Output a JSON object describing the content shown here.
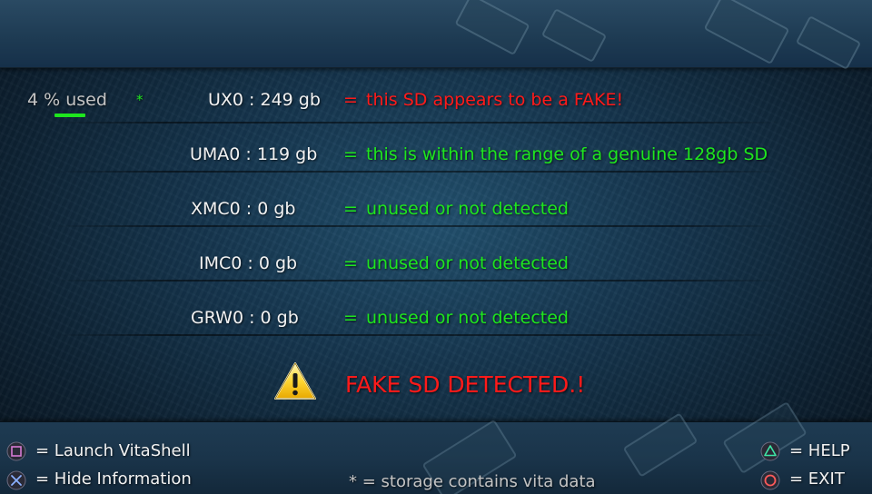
{
  "usage": {
    "label": "4 % used",
    "fraction": 0.04,
    "marker": "*"
  },
  "partitions": [
    {
      "name": "UX0 : 249 gb",
      "equals": "=",
      "message": "this SD appears to be a FAKE!",
      "status": "fake"
    },
    {
      "name": "UMA0 : 119 gb",
      "equals": "=",
      "message": "this is within the range of a genuine 128gb SD",
      "status": "ok"
    },
    {
      "name": "XMC0 : 0 gb",
      "equals": "=",
      "message": "unused or not detected",
      "status": "ok"
    },
    {
      "name": "IMC0 : 0 gb",
      "equals": "=",
      "message": "unused or not detected",
      "status": "ok"
    },
    {
      "name": "GRW0 : 0 gb",
      "equals": "=",
      "message": "unused or not detected",
      "status": "ok"
    }
  ],
  "alert": {
    "icon": "warning-triangle-icon",
    "text": "FAKE SD DETECTED.!"
  },
  "footer": {
    "square_action": "= Launch VitaShell",
    "cross_action": "= Hide Information",
    "triangle_action": "= HELP",
    "circle_action": "= EXIT",
    "note": "* = storage contains vita data"
  },
  "colors": {
    "ok": "#1ee61e",
    "fake": "#ff1a1a",
    "square_button": "#d67bd4",
    "cross_button": "#8ab0ff",
    "triangle_button": "#3ee6a6",
    "circle_button": "#ff5a5a"
  }
}
